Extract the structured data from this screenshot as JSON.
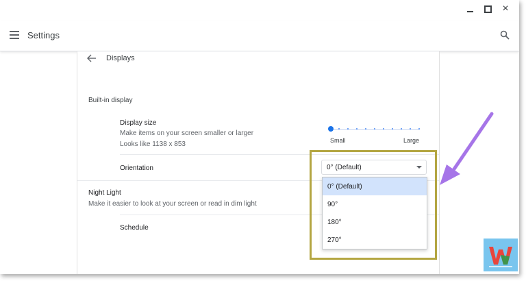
{
  "window": {
    "controls": {
      "minimize_icon": "minimize-icon",
      "maximize_icon": "maximize-icon",
      "close_label": "×"
    }
  },
  "header": {
    "menu_icon": "hamburger-menu-icon",
    "title": "Settings",
    "search_icon": "search-icon"
  },
  "page": {
    "back_icon": "back-arrow-icon",
    "title": "Displays",
    "builtin_section": "Built-in display",
    "display_size": {
      "title": "Display size",
      "description": "Make items on your screen smaller or larger",
      "looks_like": "Looks like 1138 x 853",
      "slider_min_label": "Small",
      "slider_max_label": "Large",
      "slider_value_fraction": 0.0,
      "slider_steps": 10
    },
    "orientation": {
      "label": "Orientation",
      "selected": "0° (Default)",
      "options": [
        "0° (Default)",
        "90°",
        "180°",
        "270°"
      ],
      "highlighted_index": 0
    },
    "night_light": {
      "title": "Night Light",
      "description": "Make it easier to look at your screen or read in dim light",
      "schedule_label": "Schedule"
    }
  },
  "colors": {
    "accent": "#1a73e8",
    "selected_option_bg": "#d2e3fc",
    "annotation_box": "#b4a642",
    "annotation_arrow": "#a675e8"
  }
}
